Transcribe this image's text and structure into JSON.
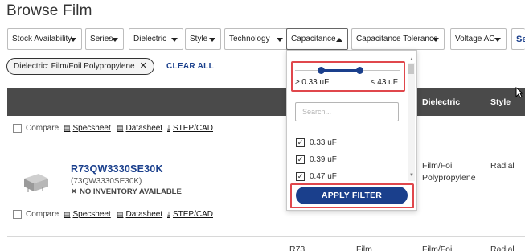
{
  "page": {
    "title": "Browse Film"
  },
  "filters": [
    {
      "label": "Stock Availability"
    },
    {
      "label": "Series"
    },
    {
      "label": "Dielectric"
    },
    {
      "label": "Style"
    },
    {
      "label": "Technology"
    },
    {
      "label": "Capacitance"
    },
    {
      "label": "Capacitance Tolerance"
    },
    {
      "label": "Voltage AC"
    },
    {
      "label": "Se"
    }
  ],
  "active_filter_chip": {
    "label": "Dielectric: Film/Foil Polypropylene",
    "remove": "✕"
  },
  "clear_all": "CLEAR ALL",
  "table": {
    "headers": {
      "dielectric": "Dielectric",
      "style": "Style"
    },
    "row1": {
      "compare": "Compare",
      "specsheet": "Specsheet",
      "datasheet": "Datasheet",
      "stepcad": "STEP/CAD"
    },
    "row2": {
      "part_number": "R73QW3330SE30K",
      "part_sub": "(73QW3330SE30K)",
      "inventory": "NO INVENTORY AVAILABLE",
      "dielectric": "Film/Foil Polypropylene",
      "style": "Radial",
      "compare": "Compare",
      "specsheet": "Specsheet",
      "datasheet": "Datasheet",
      "stepcad": "STEP/CAD"
    },
    "row3_partial": {
      "part": "R73",
      "col2": "Film",
      "dielectric": "Film/Foil",
      "style": "Radial"
    }
  },
  "capacitance_dropdown": {
    "range_min_label": "≥ 0.33 uF",
    "range_max_label": "≤ 43 uF",
    "range_min_fraction": 0.25,
    "range_max_fraction": 0.6,
    "search_placeholder": "Search...",
    "options": [
      {
        "label": "0.33 uF",
        "checked": true
      },
      {
        "label": "0.39 uF",
        "checked": true
      },
      {
        "label": "0.47 uF",
        "checked": true
      }
    ],
    "apply_label": "APPLY FILTER"
  },
  "colors": {
    "accent": "#1a3f8c",
    "highlight": "#e0474c",
    "table_header": "#4a4a4a"
  }
}
